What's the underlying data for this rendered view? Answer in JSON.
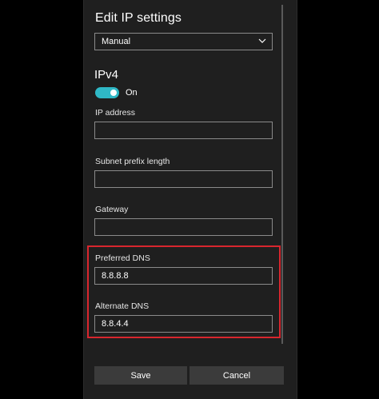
{
  "dialog": {
    "title": "Edit IP settings",
    "mode_select": {
      "value": "Manual"
    },
    "section": "IPv4",
    "toggle": {
      "label": "On",
      "state": "on",
      "accent": "#2fb8c6"
    },
    "fields": {
      "ip_address": {
        "label": "IP address",
        "value": ""
      },
      "subnet_prefix_length": {
        "label": "Subnet prefix length",
        "value": ""
      },
      "gateway": {
        "label": "Gateway",
        "value": ""
      },
      "preferred_dns": {
        "label": "Preferred DNS",
        "value": "8.8.8.8"
      },
      "alternate_dns": {
        "label": "Alternate DNS",
        "value": "8.8.4.4"
      }
    },
    "highlight_color": "#d9262e",
    "buttons": {
      "save": "Save",
      "cancel": "Cancel"
    }
  }
}
